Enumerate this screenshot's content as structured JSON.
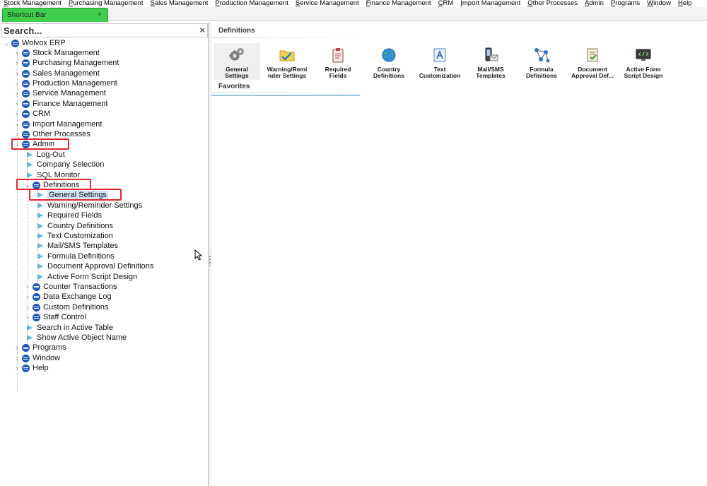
{
  "menubar": {
    "items": [
      {
        "ul": "S",
        "rest": "tock Management"
      },
      {
        "ul": "P",
        "rest": "urchasing Management"
      },
      {
        "ul": "S",
        "rest": "ales Management"
      },
      {
        "ul": "P",
        "rest": "roduction Management"
      },
      {
        "ul": "S",
        "rest": "ervice Management"
      },
      {
        "ul": "F",
        "rest": "inance Management"
      },
      {
        "ul": "C",
        "rest": "RM"
      },
      {
        "ul": "I",
        "rest": "mport Management"
      },
      {
        "ul": "O",
        "rest": "ther Processes"
      },
      {
        "ul": "A",
        "rest": "dmin"
      },
      {
        "ul": "P",
        "rest": "rograms"
      },
      {
        "ul": "W",
        "rest": "indow"
      },
      {
        "ul": "H",
        "rest": "elp"
      }
    ]
  },
  "tab": {
    "label": "Shortcut Bar",
    "close": "×"
  },
  "search": {
    "placeholder": "Search...",
    "close": "×"
  },
  "tree": {
    "root": "Wolvox ERP",
    "stock": "Stock Management",
    "purchasing": "Purchasing Management",
    "sales": "Sales Management",
    "production": "Production Management",
    "service": "Service Management",
    "finance": "Finance Management",
    "crm": "CRM",
    "import": "Import Management",
    "other": "Other Processes",
    "admin": "Admin",
    "logout": "Log-Out",
    "company": "Company Selection",
    "sql": "SQL Monitor",
    "definitions": "Definitions",
    "general": "General Settings",
    "warning": "Warning/Reminder Settings",
    "required": "Required Fields",
    "country": "Country Definitions",
    "text": "Text Customization",
    "mail": "Mail/SMS Templates",
    "formula": "Formula Definitions",
    "docapproval": "Document Approval Definitions",
    "activeform": "Active Form Script Design",
    "counter": "Counter Transactions",
    "dataex": "Data Exchange Log",
    "custom": "Custom Definitions",
    "staff": "Staff Control",
    "searchtable": "Search in Active Table",
    "showobj": "Show Active Object Name",
    "programs": "Programs",
    "window": "Window",
    "help": "Help"
  },
  "right": {
    "section_definitions": "Definitions",
    "section_favorites": "Favorites",
    "ribbon": [
      {
        "l1": "General",
        "l2": "Settings",
        "icon": "gears-icon"
      },
      {
        "l1": "Warning/Remi",
        "l2": "nder Settings",
        "icon": "warning-folder-icon"
      },
      {
        "l1": "Required",
        "l2": "Fields",
        "icon": "clipboard-icon"
      },
      {
        "l1": "Country",
        "l2": "Definitions",
        "icon": "globe-icon"
      },
      {
        "l1": "Text",
        "l2": "Customization",
        "icon": "text-edit-icon"
      },
      {
        "l1": "Mail/SMS",
        "l2": "Templates",
        "icon": "phone-mail-icon"
      },
      {
        "l1": "Formula",
        "l2": "Definitions",
        "icon": "formula-nodes-icon"
      },
      {
        "l1": "Document",
        "l2": "Approval Def...",
        "icon": "document-approve-icon"
      },
      {
        "l1": "Active Form",
        "l2": "Script Design",
        "icon": "script-monitor-icon"
      }
    ]
  },
  "colors": {
    "tab": "#3fcf4d",
    "highlight": "#e0262e",
    "tree_ball": "#1c56b8",
    "tree_leaf": "#58b7e6"
  }
}
